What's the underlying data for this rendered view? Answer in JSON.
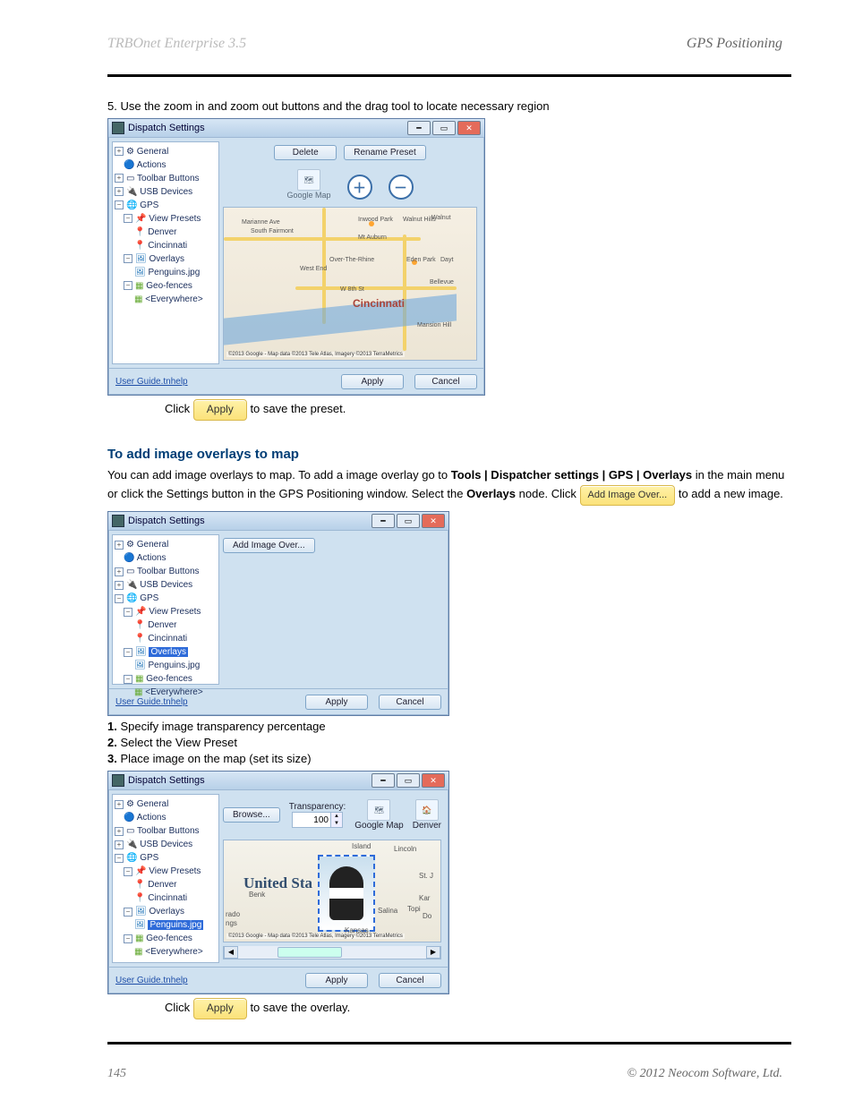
{
  "header": {
    "left": "TRBOnet Enterprise 3.5",
    "right": "GPS Positioning"
  },
  "footer": {
    "page": "145",
    "copy": "© 2012 Neocom Software, Ltd."
  },
  "text": {
    "line5a": "5.",
    "line5b": " Use the zoom in and zoom out buttons and the drag tool to locate necessary region",
    "click1": "Click ",
    "toSave1": " to save the preset.",
    "overlaysHeader": "To add image overlays to map",
    "addDescA": "You can add image overlays to map. To add a image overlay go to ",
    "addDescB": "Tools | Dispatcher settings | GPS | Overlays",
    "addDescC": " in the main menu or click the Settings button in the GPS Positioning window. Select the ",
    "addDescD": "Overlays",
    "addDescE": " node. Click ",
    "addDescF": " to add a new image.",
    "line1": "Specify image transparency percentage",
    "line2": "Select the View Preset",
    "line3": "Place image on the map (set its size)",
    "num1": "1.",
    "num2": "2.",
    "num3": "3.",
    "toSave2": " to save the overlay.",
    "dialogTitle": "Dispatch Settings",
    "tree": {
      "general": "General",
      "actions": "Actions",
      "toolbar": "Toolbar Buttons",
      "usb": "USB Devices",
      "gps": "GPS",
      "viewpresets": "View Presets",
      "denver": "Denver",
      "cincinnati": "Cincinnati",
      "overlays": "Overlays",
      "penguins": "Penguins.jpg",
      "geofences": "Geo-fences",
      "everywhere": "<Everywhere>"
    },
    "buttons": {
      "delete": "Delete",
      "rename": "Rename Preset",
      "googlemap": "Google Map",
      "apply": "Apply",
      "cancel": "Cancel",
      "addimage": "Add Image Over...",
      "browse": "Browse...",
      "transparency": "Transparency:",
      "denver": "Denver",
      "userguide": "User Guide.tnhelp"
    },
    "transparencyVal": "100",
    "map1": {
      "city": "Cincinnati",
      "cred": "©2013 Google - Map data ©2013 Tele Atlas, Imagery ©2013 TerraMetrics",
      "places": [
        "South Fairmont",
        "Walnut Hills",
        "Mt Auburn",
        "Over-The-Rhine",
        "West End",
        "Mansion Hill",
        "Bellevue",
        "Dayt",
        "Inwood Park",
        "Eden Park",
        "Walnut",
        "Marianne Ave",
        "W 8th St"
      ]
    },
    "map3": {
      "us": "United Sta",
      "cred": "©2013 Google - Map data ©2013 Tele Atlas, Imagery ©2013 TerraMetrics",
      "places": [
        "Island",
        "Lincoln",
        "St. J",
        "Kar",
        "Salina",
        "Topi",
        "Do",
        "rado",
        "ngs",
        "Benk",
        "Kansas"
      ]
    },
    "applyBtn": "Apply",
    "addImageBtn": "Add Image Over..."
  }
}
